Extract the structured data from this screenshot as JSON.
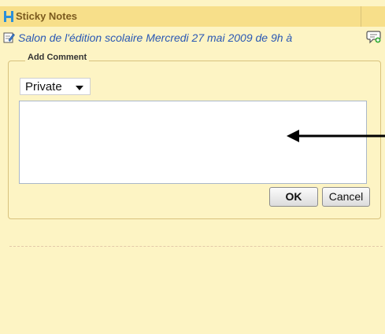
{
  "header": {
    "title": "Sticky Notes",
    "icon": "grid-logo-icon"
  },
  "note": {
    "title": "Salon de l'édition scolaire Mercredi 27 mai 2009 de 9h à",
    "icon": "edit-note-icon",
    "action_icon": "add-comment-icon"
  },
  "comment_form": {
    "legend": "Add Comment",
    "visibility_value": "Private",
    "comment_text": "",
    "ok_label": "OK",
    "cancel_label": "Cancel"
  },
  "colors": {
    "panel_bg": "#fdf4c4",
    "header_bg": "#f7df8a",
    "header_text": "#7b5a1e",
    "link_text": "#2a58b4"
  }
}
